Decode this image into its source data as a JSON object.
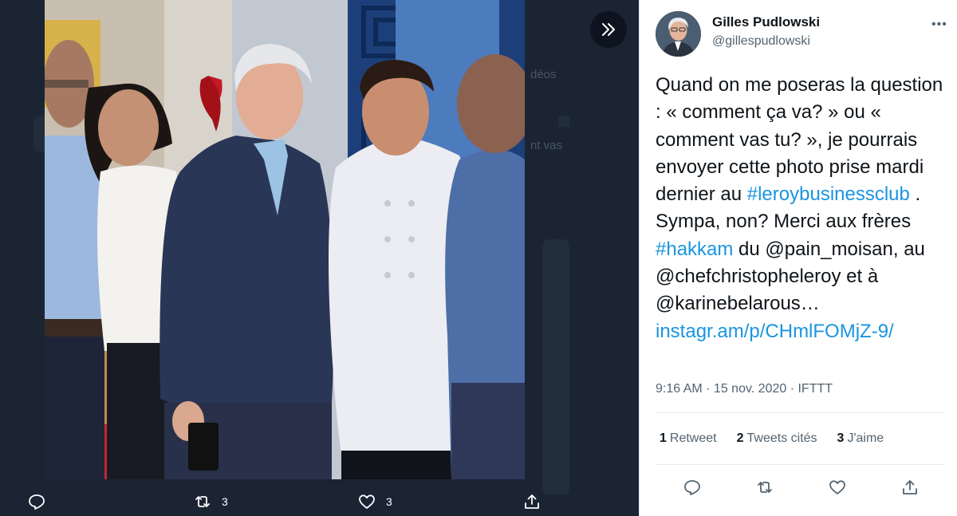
{
  "viewer": {
    "background_labels": {
      "videos": "déos",
      "how_are_you": "nt vas"
    },
    "actions": {
      "reply_count": "",
      "retweet_count": "3",
      "like_count": "3"
    }
  },
  "tweet": {
    "author_name": "Gilles Pudlowski",
    "author_handle": "@gillespudlowski",
    "more_label": "•••",
    "text": {
      "p1": "Quand on me poseras la question : « comment ça va? » ou « comment vas tu? », je pourrais envoyer cette photo prise mardi dernier au ",
      "hashtag1": "#leroybusinessclub",
      "p2": " . Sympa, non? Merci aux frères ",
      "hashtag2": "#hakkam",
      "p3": " du @pain_moisan, au @chefchristopheleroy et à @karinebelarous… ",
      "link": "instagr.am/p/CHmlFOMjZ-9/"
    },
    "meta": "9:16 AM · 15 nov. 2020 · IFTTT",
    "stats": {
      "retweets_count": "1",
      "retweets_label": "Retweet",
      "quotes_count": "2",
      "quotes_label": "Tweets cités",
      "likes_count": "3",
      "likes_label": "J'aime"
    }
  },
  "colors": {
    "link": "#1b95e0",
    "text": "#0f1419",
    "muted": "#536471",
    "viewer_bg": "#1b2433"
  },
  "icons": [
    "expand-icon",
    "reply-icon",
    "retweet-icon",
    "like-icon",
    "share-icon",
    "more-icon"
  ]
}
